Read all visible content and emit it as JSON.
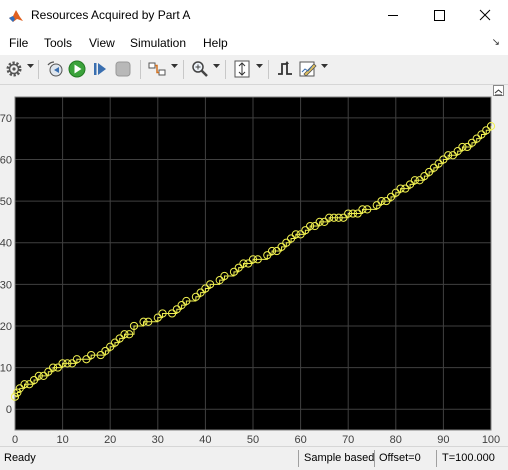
{
  "window": {
    "title": "Resources Acquired by Part A"
  },
  "menu": {
    "items": [
      "File",
      "Tools",
      "View",
      "Simulation",
      "Help"
    ]
  },
  "toolbar": {
    "icons": [
      "gear-icon",
      "step-back-icon",
      "run-icon",
      "step-forward-icon",
      "stop-icon",
      "highlight-block-icon",
      "zoom-icon",
      "autoscale-icon",
      "triggers-icon",
      "style-icon"
    ]
  },
  "status": {
    "ready": "Ready",
    "sample_mode": "Sample based",
    "offset": "Offset=0",
    "time": "T=100.000"
  },
  "colors": {
    "plot_bg": "#000000",
    "grid": "#404040",
    "trace": "#f0f050",
    "axes_text": "#c8c8c8"
  },
  "chart_data": {
    "type": "line",
    "style": "stairs with circle markers",
    "title": "",
    "xlabel": "",
    "ylabel": "",
    "xlim": [
      0,
      100
    ],
    "ylim": [
      -5,
      75
    ],
    "xticks": [
      0,
      10,
      20,
      30,
      40,
      50,
      60,
      70,
      80,
      90,
      100
    ],
    "yticks": [
      0,
      10,
      20,
      30,
      40,
      50,
      60,
      70
    ],
    "grid": true,
    "series": [
      {
        "x": [
          0,
          0.5,
          1,
          2,
          3,
          4,
          5,
          6,
          7,
          8,
          9,
          10,
          11,
          12,
          13,
          15,
          16,
          18,
          19,
          20,
          21,
          22,
          23,
          24,
          25,
          27,
          28,
          30,
          31,
          33,
          34,
          35,
          36,
          38,
          39,
          40,
          41,
          43,
          44,
          46,
          47,
          48,
          49,
          50,
          51,
          53,
          54,
          55,
          56,
          57,
          58,
          59,
          60,
          61,
          62,
          63,
          64,
          65,
          66,
          67,
          68,
          69,
          70,
          71,
          72,
          73,
          74,
          76,
          77,
          78,
          79,
          80,
          81,
          82,
          83,
          84,
          85,
          86,
          87,
          88,
          89,
          90,
          91,
          92,
          93,
          94,
          95,
          96,
          97,
          98,
          99,
          100
        ],
        "y": [
          3,
          4,
          5,
          6,
          6,
          7,
          8,
          8,
          9,
          10,
          10,
          11,
          11,
          11,
          12,
          12,
          13,
          13,
          14,
          15,
          16,
          17,
          18,
          18,
          20,
          21,
          21,
          22,
          23,
          23,
          24,
          25,
          26,
          27,
          28,
          29,
          30,
          31,
          32,
          33,
          34,
          35,
          35,
          36,
          36,
          37,
          38,
          38,
          39,
          40,
          41,
          42,
          42,
          43,
          44,
          44,
          45,
          45,
          46,
          46,
          46,
          46,
          47,
          47,
          47,
          48,
          48,
          49,
          50,
          50,
          51,
          52,
          53,
          53,
          54,
          55,
          55,
          56,
          57,
          58,
          59,
          60,
          61,
          61,
          62,
          63,
          63,
          64,
          65,
          66,
          67,
          68
        ]
      }
    ]
  }
}
